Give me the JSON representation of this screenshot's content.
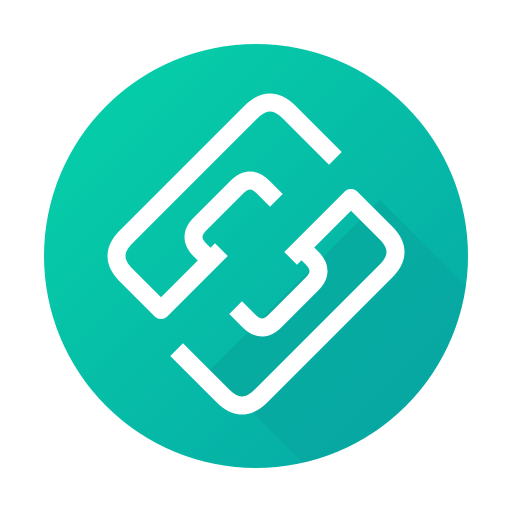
{
  "app_icon": {
    "name": "chain-link-icon",
    "colors": {
      "circle_gradient_start": "#05D3A8",
      "circle_gradient_end": "#07A6A6",
      "glyph": "#FFFFFF",
      "long_shadow": "#0A7F85",
      "background": "#FFFFFF"
    }
  }
}
